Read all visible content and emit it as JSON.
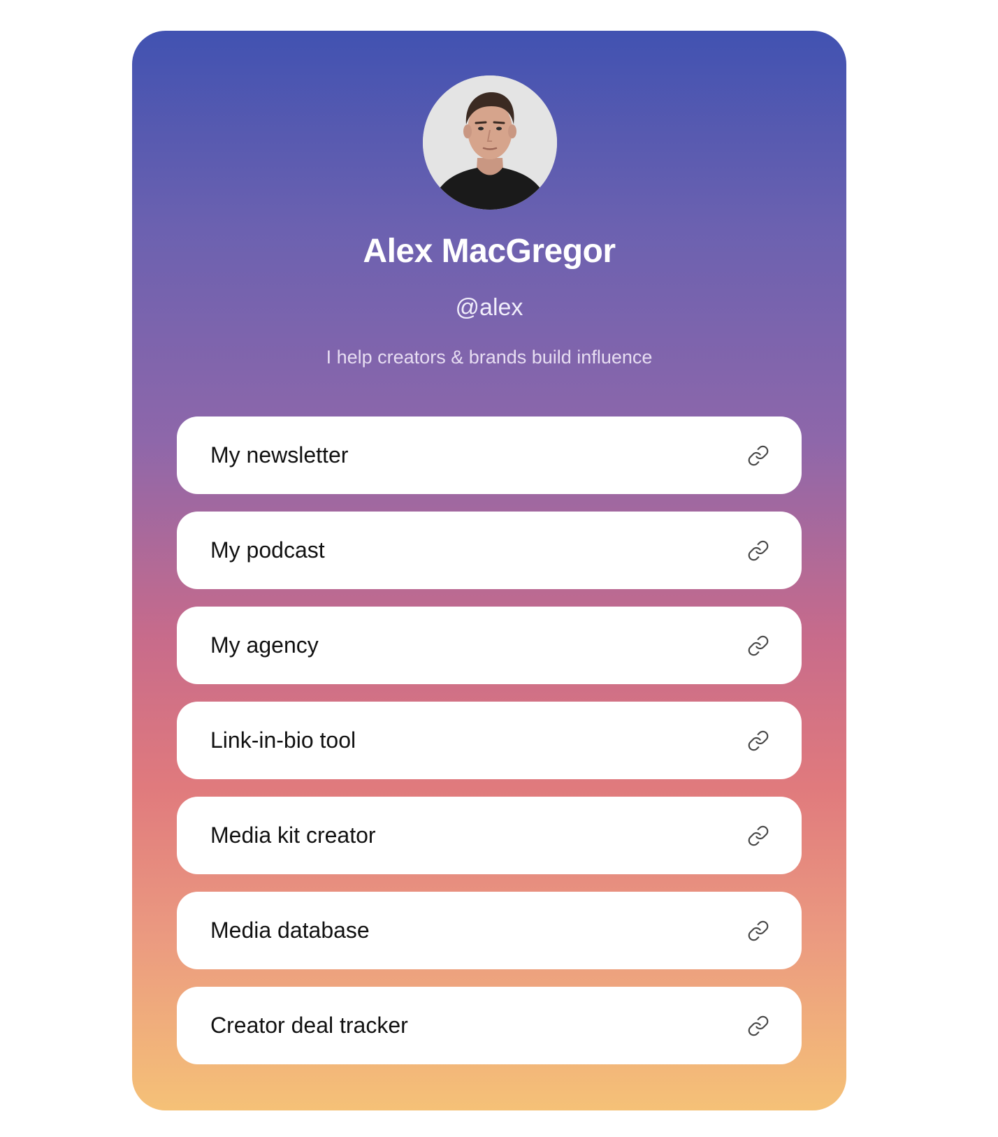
{
  "profile": {
    "name": "Alex MacGregor",
    "handle": "@alex",
    "bio": "I help creators & brands build influence"
  },
  "links": [
    {
      "label": "My newsletter",
      "icon": "link-icon"
    },
    {
      "label": "My podcast",
      "icon": "link-icon"
    },
    {
      "label": "My agency",
      "icon": "link-icon"
    },
    {
      "label": "Link-in-bio tool",
      "icon": "link-icon"
    },
    {
      "label": "Media kit creator",
      "icon": "link-icon"
    },
    {
      "label": "Media database",
      "icon": "link-icon"
    },
    {
      "label": "Creator deal tracker",
      "icon": "link-icon"
    }
  ],
  "colors": {
    "gradient_top": "#4152b1",
    "gradient_mid": "#c76b8b",
    "gradient_bottom": "#f5c177",
    "button_bg": "#ffffff",
    "button_text": "#111111"
  }
}
